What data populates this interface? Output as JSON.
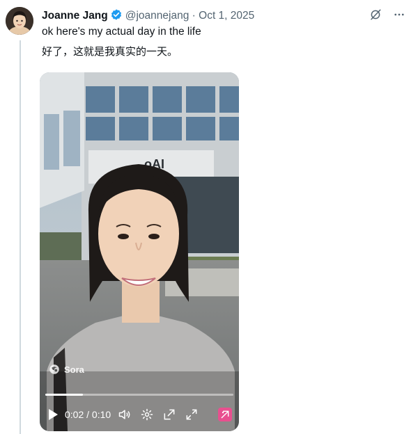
{
  "post": {
    "author": {
      "name": "Joanne Jang",
      "handle": "@joannejang",
      "verified": true
    },
    "separator": "·",
    "date": "Oct 1, 2025",
    "text_lines": [
      "ok here's my actual day in the life",
      "好了，这就是我真实的一天。"
    ]
  },
  "video": {
    "watermark": "Sora",
    "sign_text": "oAI",
    "current_time": "0:02",
    "time_separator": " / ",
    "duration": "0:10",
    "progress_fraction": 0.2
  },
  "colors": {
    "verified_badge": "#1d9bf0",
    "secondary_text": "#536471",
    "thread_line": "#cfd9de",
    "grok_button": "#e8508f"
  },
  "icons": [
    "verified-badge-icon",
    "grok-icon",
    "more-icon",
    "play-icon",
    "volume-icon",
    "settings-icon",
    "pip-icon",
    "fullscreen-icon",
    "sora-logo-icon"
  ]
}
